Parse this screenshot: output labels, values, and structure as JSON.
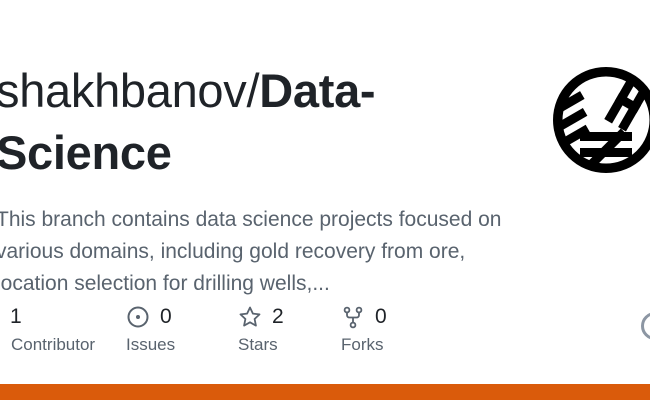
{
  "repo": {
    "owner": "shakhbanov/",
    "name": "Data-Science",
    "description": "This branch contains data science projects focused on various domains, including gold recovery from ore, location selection for drilling wells,..."
  },
  "stats": [
    {
      "count": "1",
      "label": "Contributor",
      "icon": "people-icon"
    },
    {
      "count": "0",
      "label": "Issues",
      "icon": "issue-opened-icon"
    },
    {
      "count": "2",
      "label": "Stars",
      "icon": "star-icon"
    },
    {
      "count": "0",
      "label": "Forks",
      "icon": "repo-forked-icon"
    }
  ],
  "logo": {
    "icon": "shz-monogram-logo"
  },
  "colors": {
    "title": "#1f2328",
    "muted": "#59636e",
    "language_bar": "#DA5B0B"
  }
}
